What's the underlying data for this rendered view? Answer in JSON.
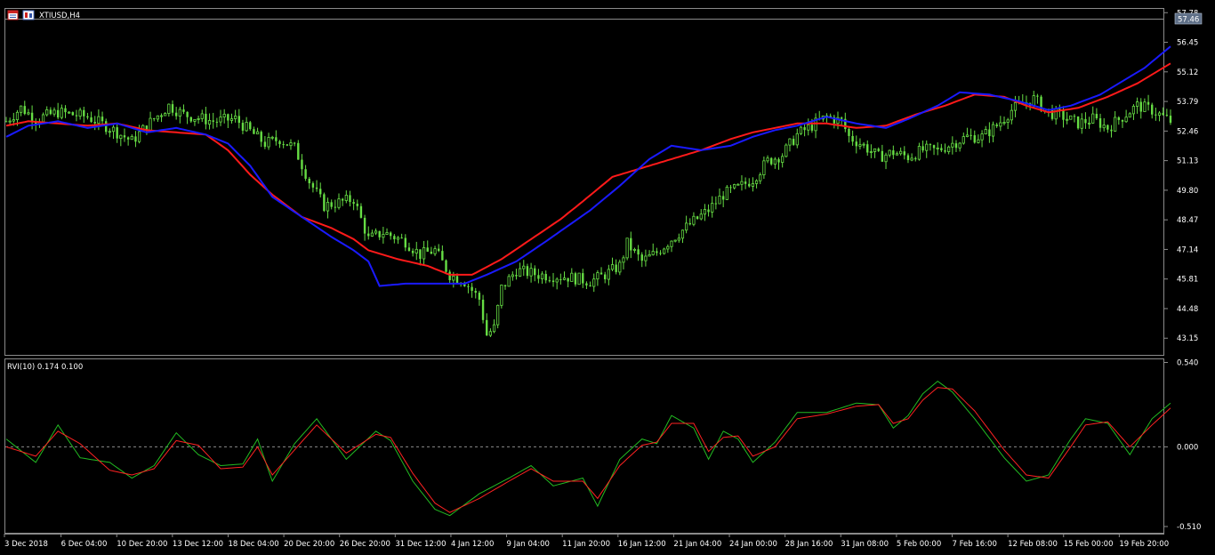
{
  "chart_data": [
    {
      "type": "candlestick",
      "symbol_label": "XTIUSD,H4",
      "y_tick_labels": [
        "57.78",
        "56.45",
        "55.12",
        "53.79",
        "52.46",
        "51.13",
        "49.80",
        "48.47",
        "47.14",
        "45.81",
        "44.48",
        "43.15"
      ],
      "y_tick_values": [
        57.78,
        56.45,
        55.12,
        53.79,
        52.46,
        51.13,
        49.8,
        48.47,
        47.14,
        45.81,
        44.48,
        43.15
      ],
      "ylim": [
        42.4,
        57.95
      ],
      "current_price": "57.46",
      "x_labels": [
        "3 Dec 2018",
        "6 Dec 04:00",
        "10 Dec 20:00",
        "13 Dec 12:00",
        "18 Dec 04:00",
        "20 Dec 20:00",
        "26 Dec 20:00",
        "31 Dec 12:00",
        "4 Jan 12:00",
        "9 Jan 04:00",
        "11 Jan 20:00",
        "16 Jan 12:00",
        "21 Jan 04:00",
        "24 Jan 00:00",
        "28 Jan 16:00",
        "31 Jan 08:00",
        "5 Feb 00:00",
        "7 Feb 16:00",
        "12 Feb 08:00",
        "15 Feb 00:00",
        "19 Feb 20:00"
      ],
      "n_bars": 316,
      "price_path": [
        [
          0,
          52.9
        ],
        [
          4,
          53.5
        ],
        [
          8,
          53.0
        ],
        [
          14,
          53.3
        ],
        [
          22,
          53.1
        ],
        [
          28,
          52.6
        ],
        [
          34,
          52.0
        ],
        [
          38,
          52.7
        ],
        [
          44,
          53.6
        ],
        [
          48,
          53.2
        ],
        [
          56,
          52.9
        ],
        [
          62,
          53.0
        ],
        [
          70,
          51.9
        ],
        [
          74,
          52.1
        ],
        [
          78,
          51.7
        ],
        [
          82,
          50.2
        ],
        [
          86,
          49.1
        ],
        [
          94,
          49.4
        ],
        [
          98,
          47.6
        ],
        [
          102,
          47.9
        ],
        [
          108,
          47.5
        ],
        [
          112,
          46.9
        ],
        [
          116,
          47.1
        ],
        [
          120,
          46.0
        ],
        [
          124,
          45.7
        ],
        [
          128,
          44.9
        ],
        [
          130,
          43.3
        ],
        [
          132,
          43.6
        ],
        [
          134,
          45.4
        ],
        [
          138,
          46.2
        ],
        [
          144,
          46.0
        ],
        [
          152,
          45.9
        ],
        [
          158,
          45.7
        ],
        [
          162,
          46.0
        ],
        [
          166,
          46.4
        ],
        [
          168,
          47.4
        ],
        [
          172,
          46.6
        ],
        [
          176,
          47.0
        ],
        [
          180,
          47.6
        ],
        [
          186,
          48.4
        ],
        [
          190,
          48.9
        ],
        [
          194,
          49.6
        ],
        [
          198,
          49.9
        ],
        [
          202,
          50.3
        ],
        [
          206,
          51.1
        ],
        [
          210,
          51.4
        ],
        [
          214,
          52.3
        ],
        [
          218,
          52.7
        ],
        [
          222,
          53.1
        ],
        [
          226,
          52.9
        ],
        [
          228,
          52.2
        ],
        [
          232,
          51.8
        ],
        [
          236,
          51.3
        ],
        [
          240,
          51.5
        ],
        [
          244,
          51.3
        ],
        [
          248,
          51.6
        ],
        [
          252,
          51.6
        ],
        [
          256,
          51.9
        ],
        [
          260,
          52.2
        ],
        [
          264,
          52.2
        ],
        [
          268,
          52.7
        ],
        [
          272,
          53.4
        ],
        [
          274,
          53.6
        ],
        [
          278,
          53.9
        ],
        [
          282,
          53.3
        ],
        [
          286,
          53.1
        ],
        [
          290,
          52.8
        ],
        [
          294,
          53.0
        ],
        [
          298,
          52.6
        ],
        [
          302,
          53.1
        ],
        [
          306,
          53.6
        ],
        [
          310,
          53.4
        ],
        [
          313,
          53.1
        ],
        [
          316,
          52.8
        ]
      ],
      "ma_fast_points": [
        [
          0,
          52.2
        ],
        [
          6,
          52.7
        ],
        [
          14,
          52.9
        ],
        [
          22,
          52.6
        ],
        [
          30,
          52.8
        ],
        [
          38,
          52.4
        ],
        [
          46,
          52.6
        ],
        [
          54,
          52.3
        ],
        [
          60,
          51.9
        ],
        [
          66,
          50.9
        ],
        [
          72,
          49.5
        ],
        [
          80,
          48.6
        ],
        [
          88,
          47.7
        ],
        [
          94,
          47.1
        ],
        [
          98,
          46.6
        ],
        [
          101,
          45.5
        ],
        [
          108,
          45.6
        ],
        [
          116,
          45.6
        ],
        [
          124,
          45.6
        ],
        [
          130,
          46.0
        ],
        [
          138,
          46.6
        ],
        [
          146,
          47.5
        ],
        [
          152,
          48.2
        ],
        [
          158,
          48.9
        ],
        [
          166,
          50.0
        ],
        [
          174,
          51.2
        ],
        [
          180,
          51.8
        ],
        [
          188,
          51.6
        ],
        [
          196,
          51.8
        ],
        [
          202,
          52.2
        ],
        [
          208,
          52.5
        ],
        [
          214,
          52.7
        ],
        [
          222,
          53.1
        ],
        [
          230,
          52.8
        ],
        [
          238,
          52.6
        ],
        [
          244,
          53.0
        ],
        [
          252,
          53.6
        ],
        [
          258,
          54.2
        ],
        [
          266,
          54.1
        ],
        [
          274,
          53.8
        ],
        [
          282,
          53.4
        ],
        [
          288,
          53.6
        ],
        [
          296,
          54.1
        ],
        [
          302,
          54.7
        ],
        [
          308,
          55.3
        ],
        [
          316,
          56.4
        ]
      ],
      "ma_slow_points": [
        [
          0,
          52.7
        ],
        [
          6,
          52.9
        ],
        [
          14,
          52.8
        ],
        [
          22,
          52.7
        ],
        [
          30,
          52.8
        ],
        [
          38,
          52.5
        ],
        [
          46,
          52.4
        ],
        [
          54,
          52.3
        ],
        [
          60,
          51.6
        ],
        [
          66,
          50.5
        ],
        [
          72,
          49.6
        ],
        [
          80,
          48.6
        ],
        [
          88,
          48.1
        ],
        [
          94,
          47.6
        ],
        [
          98,
          47.1
        ],
        [
          106,
          46.7
        ],
        [
          114,
          46.4
        ],
        [
          120,
          46.0
        ],
        [
          126,
          46.0
        ],
        [
          134,
          46.7
        ],
        [
          142,
          47.6
        ],
        [
          150,
          48.5
        ],
        [
          156,
          49.3
        ],
        [
          164,
          50.4
        ],
        [
          172,
          50.8
        ],
        [
          180,
          51.2
        ],
        [
          188,
          51.6
        ],
        [
          196,
          52.1
        ],
        [
          202,
          52.4
        ],
        [
          208,
          52.6
        ],
        [
          214,
          52.8
        ],
        [
          222,
          52.8
        ],
        [
          230,
          52.6
        ],
        [
          238,
          52.7
        ],
        [
          246,
          53.2
        ],
        [
          254,
          53.6
        ],
        [
          262,
          54.1
        ],
        [
          270,
          54.0
        ],
        [
          276,
          53.6
        ],
        [
          282,
          53.3
        ],
        [
          290,
          53.5
        ],
        [
          298,
          54.0
        ],
        [
          306,
          54.6
        ],
        [
          316,
          55.6
        ]
      ],
      "colors": {
        "candle": "#66dd44",
        "ma_fast": "#1a1aff",
        "ma_slow": "#ff1a1a",
        "grid": "#8a8a8a",
        "price_box": "#5e6f87"
      }
    },
    {
      "type": "line",
      "indicator_label": "RVI(10) 0.174 0.100",
      "y_tick_labels": [
        "0.540",
        "0.000",
        "-0.510"
      ],
      "y_tick_values": [
        0.54,
        0.0,
        -0.51
      ],
      "ylim": [
        -0.55,
        0.56
      ],
      "series": [
        {
          "color": "#22bb22",
          "points": [
            [
              0,
              0.05
            ],
            [
              8,
              -0.1
            ],
            [
              14,
              0.14
            ],
            [
              20,
              -0.07
            ],
            [
              28,
              -0.1
            ],
            [
              34,
              -0.2
            ],
            [
              40,
              -0.12
            ],
            [
              46,
              0.09
            ],
            [
              52,
              -0.05
            ],
            [
              58,
              -0.12
            ],
            [
              64,
              -0.11
            ],
            [
              68,
              0.05
            ],
            [
              72,
              -0.22
            ],
            [
              78,
              0.02
            ],
            [
              84,
              0.18
            ],
            [
              92,
              -0.08
            ],
            [
              100,
              0.1
            ],
            [
              104,
              0.04
            ],
            [
              110,
              -0.22
            ],
            [
              116,
              -0.4
            ],
            [
              120,
              -0.44
            ],
            [
              128,
              -0.3
            ],
            [
              136,
              -0.2
            ],
            [
              142,
              -0.12
            ],
            [
              148,
              -0.25
            ],
            [
              156,
              -0.2
            ],
            [
              160,
              -0.38
            ],
            [
              166,
              -0.08
            ],
            [
              172,
              0.05
            ],
            [
              176,
              0.02
            ],
            [
              180,
              0.2
            ],
            [
              186,
              0.12
            ],
            [
              190,
              -0.08
            ],
            [
              194,
              0.1
            ],
            [
              198,
              0.05
            ],
            [
              202,
              -0.1
            ],
            [
              208,
              0.03
            ],
            [
              214,
              0.22
            ],
            [
              222,
              0.22
            ],
            [
              230,
              0.28
            ],
            [
              236,
              0.27
            ],
            [
              240,
              0.12
            ],
            [
              244,
              0.2
            ],
            [
              248,
              0.34
            ],
            [
              252,
              0.42
            ],
            [
              256,
              0.35
            ],
            [
              262,
              0.18
            ],
            [
              270,
              -0.07
            ],
            [
              276,
              -0.22
            ],
            [
              282,
              -0.18
            ],
            [
              288,
              0.05
            ],
            [
              292,
              0.18
            ],
            [
              298,
              0.15
            ],
            [
              304,
              -0.05
            ],
            [
              310,
              0.18
            ],
            [
              316,
              0.3
            ]
          ]
        },
        {
          "color": "#ff2222",
          "points": [
            [
              0,
              0.0
            ],
            [
              8,
              -0.06
            ],
            [
              14,
              0.1
            ],
            [
              20,
              0.02
            ],
            [
              28,
              -0.15
            ],
            [
              34,
              -0.18
            ],
            [
              40,
              -0.14
            ],
            [
              46,
              0.04
            ],
            [
              52,
              0.01
            ],
            [
              58,
              -0.14
            ],
            [
              64,
              -0.13
            ],
            [
              68,
              0.0
            ],
            [
              72,
              -0.18
            ],
            [
              78,
              -0.02
            ],
            [
              84,
              0.14
            ],
            [
              92,
              -0.04
            ],
            [
              100,
              0.08
            ],
            [
              104,
              0.06
            ],
            [
              110,
              -0.17
            ],
            [
              116,
              -0.36
            ],
            [
              120,
              -0.42
            ],
            [
              128,
              -0.33
            ],
            [
              136,
              -0.22
            ],
            [
              142,
              -0.14
            ],
            [
              148,
              -0.22
            ],
            [
              156,
              -0.22
            ],
            [
              160,
              -0.33
            ],
            [
              166,
              -0.12
            ],
            [
              172,
              0.01
            ],
            [
              176,
              0.03
            ],
            [
              180,
              0.15
            ],
            [
              186,
              0.15
            ],
            [
              190,
              -0.03
            ],
            [
              194,
              0.06
            ],
            [
              198,
              0.07
            ],
            [
              202,
              -0.06
            ],
            [
              208,
              0.0
            ],
            [
              214,
              0.18
            ],
            [
              222,
              0.21
            ],
            [
              230,
              0.26
            ],
            [
              236,
              0.27
            ],
            [
              240,
              0.15
            ],
            [
              244,
              0.18
            ],
            [
              248,
              0.3
            ],
            [
              252,
              0.38
            ],
            [
              256,
              0.37
            ],
            [
              262,
              0.23
            ],
            [
              270,
              -0.02
            ],
            [
              276,
              -0.18
            ],
            [
              282,
              -0.2
            ],
            [
              288,
              0.0
            ],
            [
              292,
              0.14
            ],
            [
              298,
              0.16
            ],
            [
              304,
              0.0
            ],
            [
              310,
              0.14
            ],
            [
              316,
              0.27
            ]
          ]
        }
      ],
      "zero_line": 0.0
    }
  ]
}
